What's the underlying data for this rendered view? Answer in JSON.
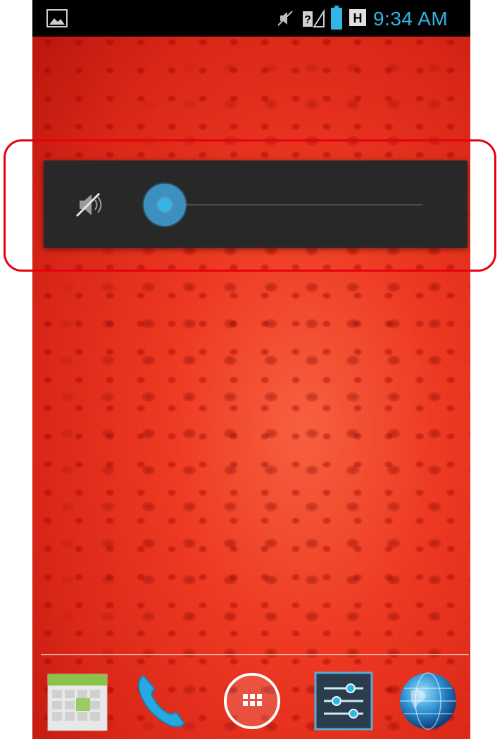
{
  "status_bar": {
    "time": "9:34 AM",
    "network_badge": "H",
    "icons": [
      "gallery-icon",
      "mute-icon",
      "no-sim-signal-icon",
      "battery-icon",
      "h-network-icon"
    ]
  },
  "volume_panel": {
    "icon": "speaker-mute-icon",
    "level": 0,
    "max": 1
  },
  "dock": {
    "apps": [
      "calendar-icon",
      "phone-icon",
      "app-drawer-icon",
      "settings-icon",
      "browser-icon"
    ]
  },
  "colors": {
    "accent": "#33b5e5",
    "panel": "#282828",
    "highlight": "#e8000c",
    "wallpaper": "#ee3a22"
  }
}
